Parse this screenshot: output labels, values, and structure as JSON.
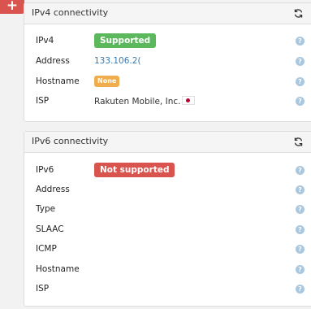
{
  "corner_button": {
    "label": "+"
  },
  "ipv4": {
    "title": "IPv4 connectivity",
    "rows": [
      {
        "label": "IPv4",
        "badge": "Supported"
      },
      {
        "label": "Address",
        "value": "133.106.2("
      },
      {
        "label": "Hostname",
        "badge": "None"
      },
      {
        "label": "ISP",
        "value": "Rakuten Mobile, Inc."
      }
    ]
  },
  "ipv6": {
    "title": "IPv6 connectivity",
    "rows": [
      {
        "label": "IPv6",
        "badge": "Not supported"
      },
      {
        "label": "Address"
      },
      {
        "label": "Type"
      },
      {
        "label": "SLAAC"
      },
      {
        "label": "ICMP"
      },
      {
        "label": "Hostname"
      },
      {
        "label": "ISP"
      }
    ]
  },
  "help_icon_glyph": "?",
  "colors": {
    "success": "#5cb85c",
    "warning": "#f0ad4e",
    "danger": "#d9534f",
    "link": "#337ab7"
  }
}
